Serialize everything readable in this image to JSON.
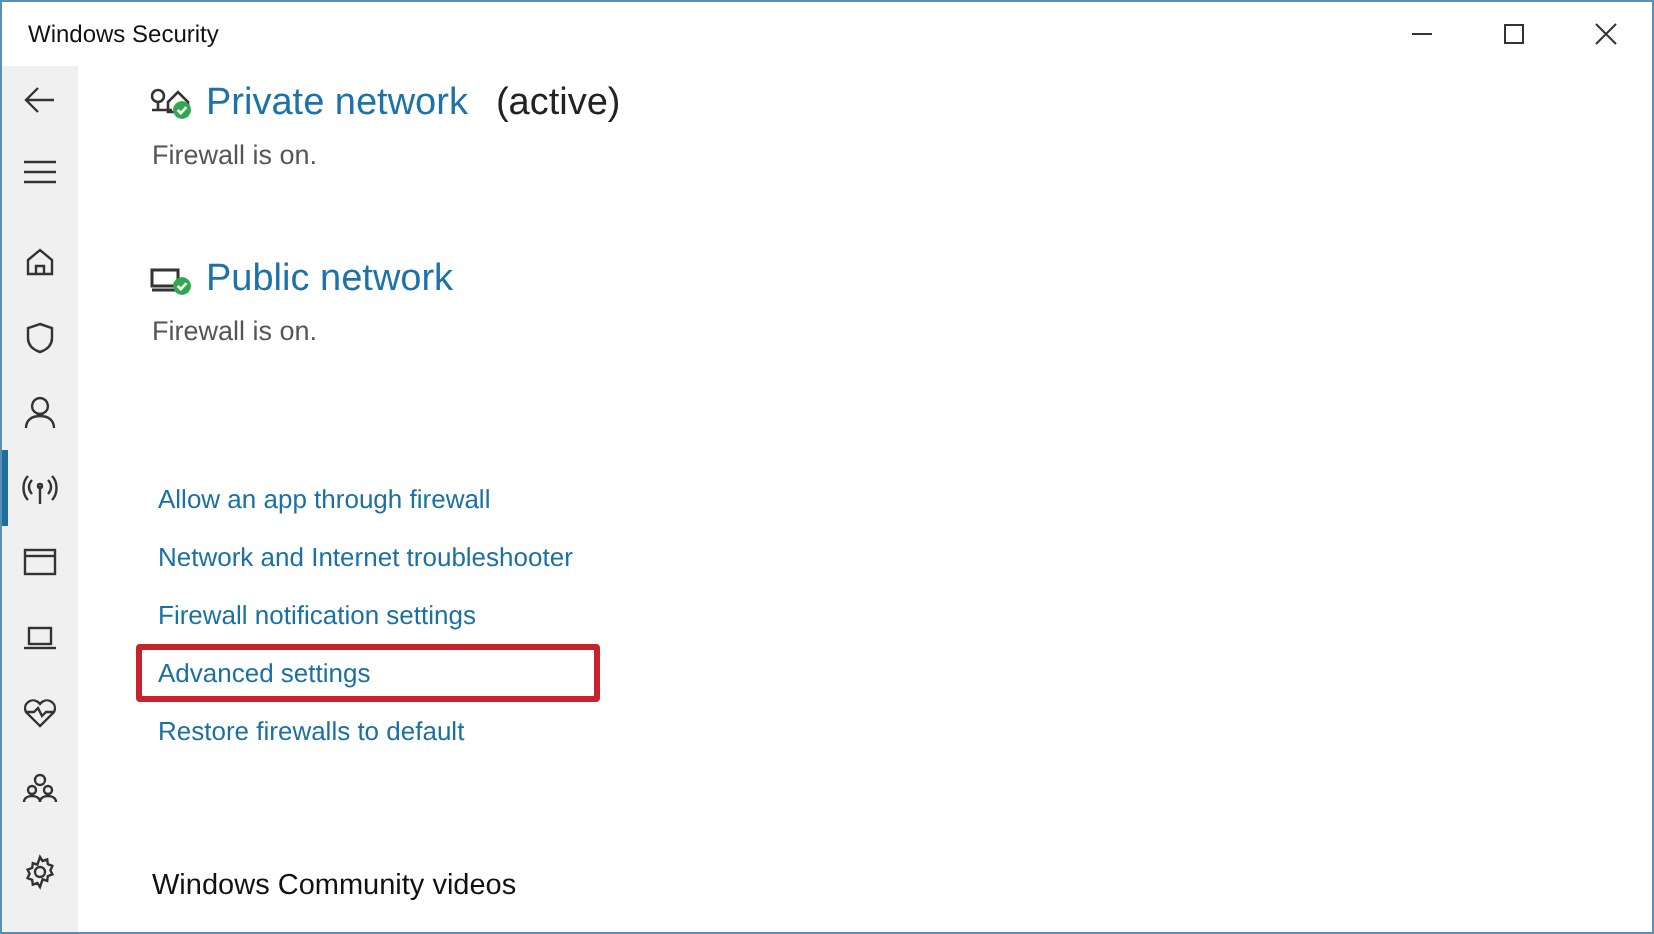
{
  "window": {
    "title": "Windows Security"
  },
  "sidebar": {
    "items": [
      {
        "kind": "back",
        "selected": false
      },
      {
        "kind": "menu",
        "selected": false
      },
      {
        "kind": "home",
        "selected": false
      },
      {
        "kind": "shield",
        "selected": false
      },
      {
        "kind": "person",
        "selected": false
      },
      {
        "kind": "wireless",
        "selected": true
      },
      {
        "kind": "window",
        "selected": false
      },
      {
        "kind": "laptop",
        "selected": false
      },
      {
        "kind": "heart",
        "selected": false
      },
      {
        "kind": "family",
        "selected": false
      },
      {
        "kind": "settings",
        "selected": false
      }
    ]
  },
  "networks": [
    {
      "kind": "private",
      "name": "Private network",
      "badge": "(active)",
      "status": "Firewall is on."
    },
    {
      "kind": "public",
      "name": "Public network",
      "status": "Firewall is on."
    }
  ],
  "links": [
    {
      "label": "Allow an app through firewall",
      "highlighted": false
    },
    {
      "label": "Network and Internet troubleshooter",
      "highlighted": false
    },
    {
      "label": "Firewall notification settings",
      "highlighted": false
    },
    {
      "label": "Advanced settings",
      "highlighted": true
    },
    {
      "label": "Restore firewalls to default",
      "highlighted": false
    }
  ],
  "community": {
    "heading": "Windows Community videos"
  }
}
